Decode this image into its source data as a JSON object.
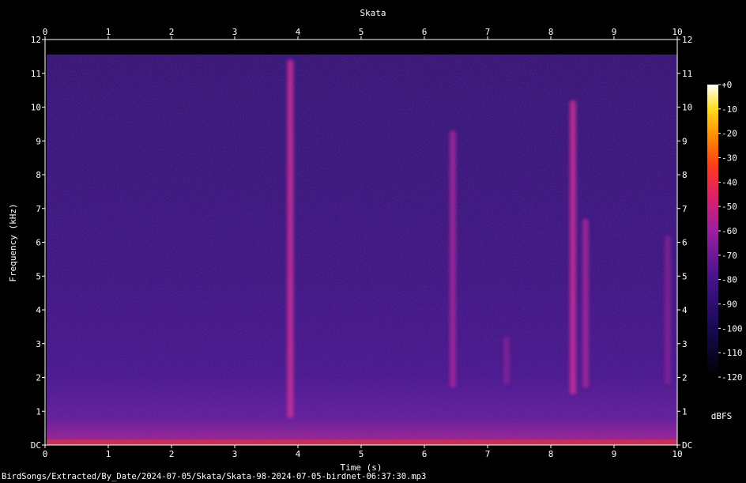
{
  "chart_data": {
    "type": "heatmap",
    "title": "Skata",
    "xlabel": "Time (s)",
    "ylabel": "Frequency (kHz)",
    "xlim": [
      0,
      10
    ],
    "ylim": [
      0,
      12
    ],
    "x_ticks": [
      "0",
      "1",
      "2",
      "3",
      "4",
      "5",
      "6",
      "7",
      "8",
      "9",
      "10"
    ],
    "y_ticks": [
      "DC",
      "1",
      "2",
      "3",
      "4",
      "5",
      "6",
      "7",
      "8",
      "9",
      "10",
      "11",
      "12"
    ],
    "colorbar": {
      "unit": "dBFS",
      "range": [
        -120,
        0
      ],
      "ticks": [
        "+0",
        "-10",
        "-20",
        "-30",
        "-40",
        "-50",
        "-60",
        "-70",
        "-80",
        "-90",
        "-100",
        "-110",
        "-120"
      ]
    },
    "colors": {
      "background": "#000000",
      "noise": "#2a0d6e",
      "call": "#c02a9a",
      "peak": "#ffee60"
    },
    "calls": [
      {
        "t": 3.88,
        "f_low": 0.8,
        "f_high": 11.4,
        "level": -60
      },
      {
        "t": 6.45,
        "f_low": 1.7,
        "f_high": 9.3,
        "level": -65
      },
      {
        "t": 7.3,
        "f_low": 1.8,
        "f_high": 3.2,
        "level": -72
      },
      {
        "t": 8.35,
        "f_low": 1.5,
        "f_high": 10.2,
        "level": -62
      },
      {
        "t": 8.55,
        "f_low": 1.7,
        "f_high": 6.7,
        "level": -66
      },
      {
        "t": 9.85,
        "f_low": 1.8,
        "f_high": 6.2,
        "level": -75
      }
    ]
  },
  "footer": {
    "filepath": "BirdSongs/Extracted/By_Date/2024-07-05/Skata/Skata-98-2024-07-05-birdnet-06:37:30.mp3"
  }
}
